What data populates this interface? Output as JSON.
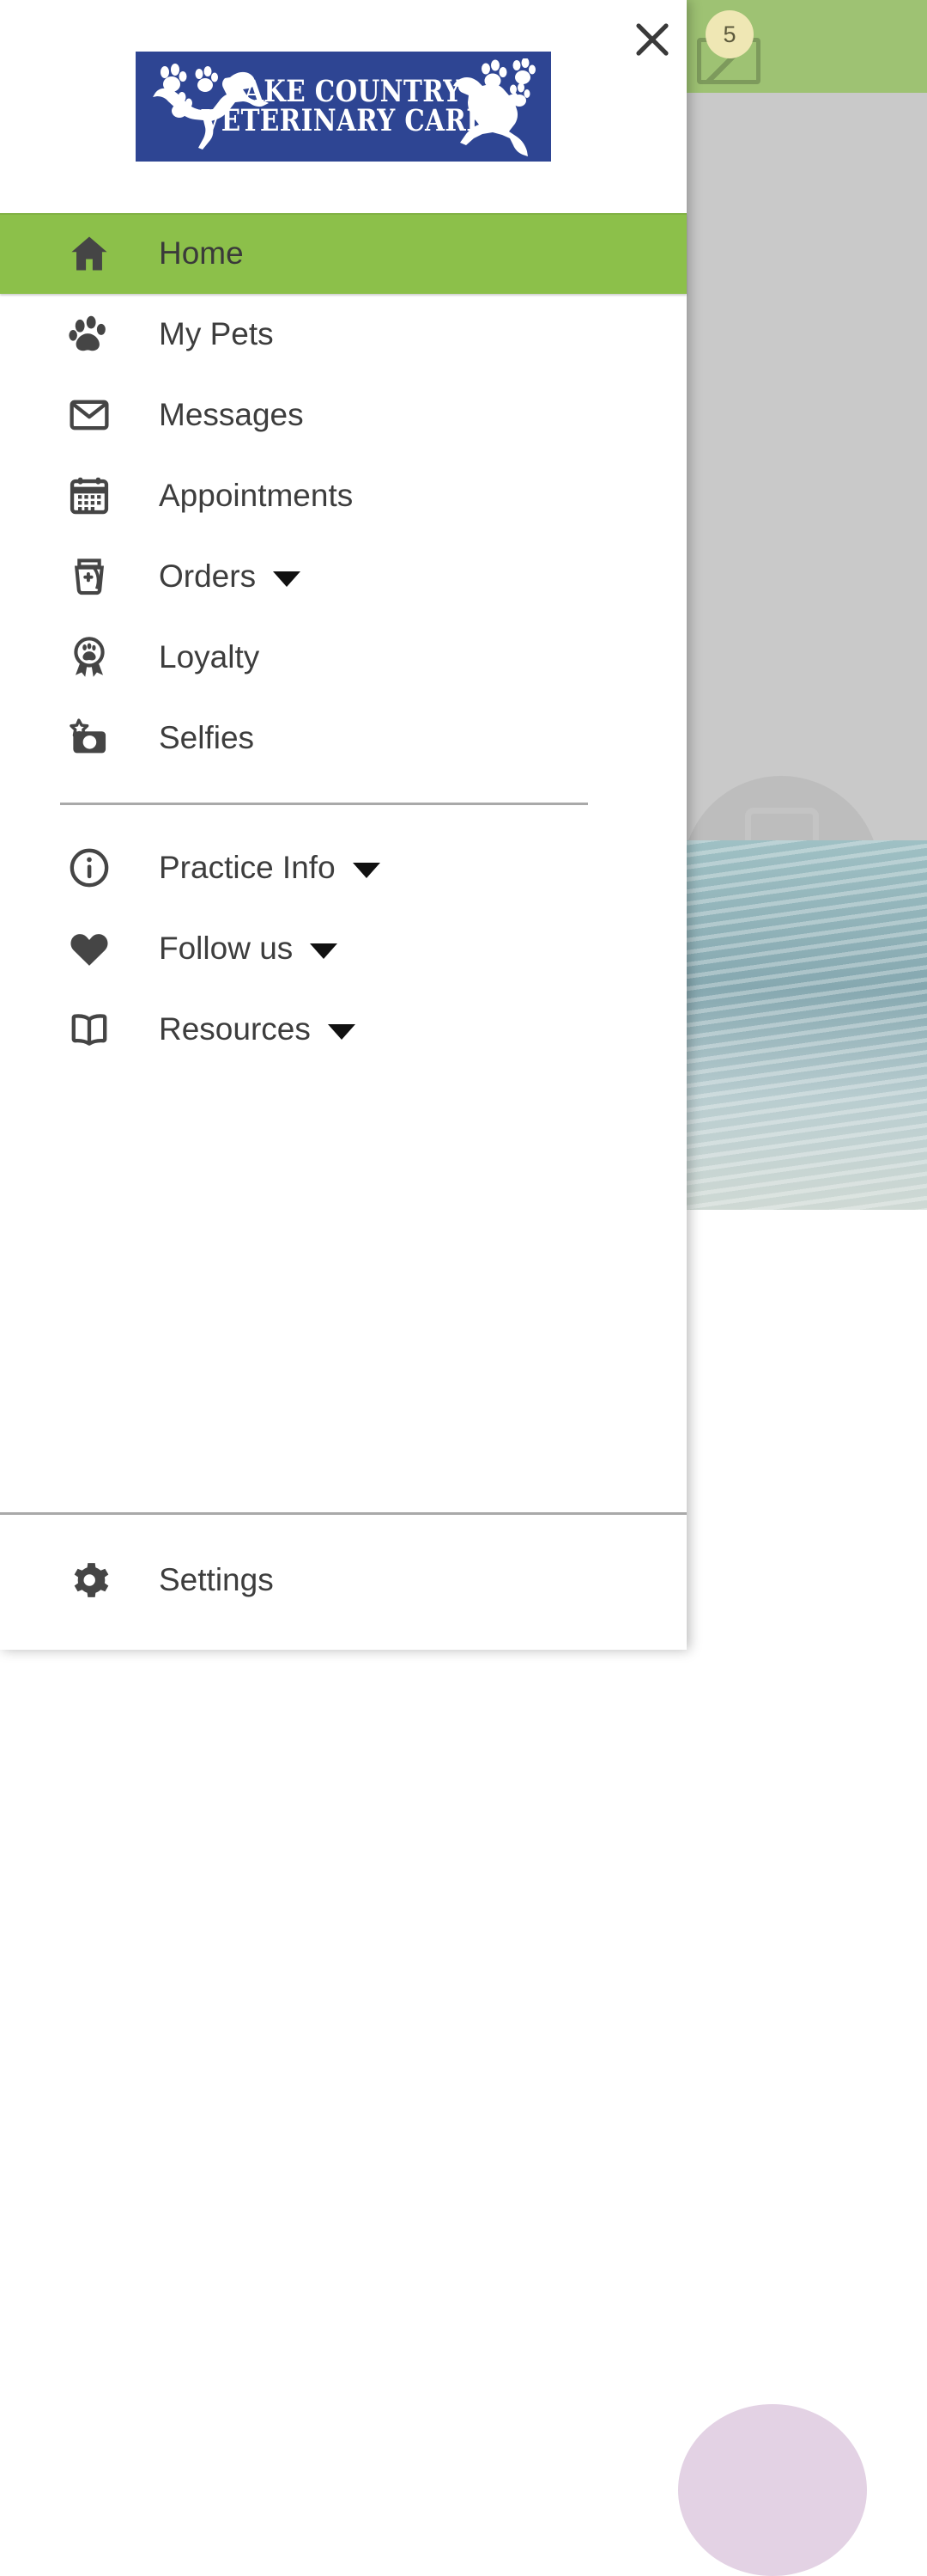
{
  "background_app": {
    "badge_count": "5",
    "envelope_icon": "envelope-icon"
  },
  "drawer": {
    "close_button": {
      "icon": "close-icon",
      "label": "Close"
    },
    "logo": {
      "line1": "Lake Country",
      "line2": "Veterinary Care",
      "background_color": "#2E4593",
      "text_color": "#FFFFFF",
      "dog_icon": "dog-silhouette-icon",
      "cat_icon": "cat-silhouette-icon",
      "paw_icon": "paw-print-icon"
    },
    "accent_color": "#8CC04A",
    "icon_color": "#454545",
    "primary_items": [
      {
        "label": "Home",
        "icon": "home-icon",
        "active": true,
        "expandable": false
      },
      {
        "label": "My Pets",
        "icon": "paw-icon",
        "active": false,
        "expandable": false
      },
      {
        "label": "Messages",
        "icon": "envelope-icon",
        "active": false,
        "expandable": false
      },
      {
        "label": "Appointments",
        "icon": "calendar-icon",
        "active": false,
        "expandable": false
      },
      {
        "label": "Orders",
        "icon": "food-bag-icon",
        "active": false,
        "expandable": true
      },
      {
        "label": "Loyalty",
        "icon": "award-paw-icon",
        "active": false,
        "expandable": false
      },
      {
        "label": "Selfies",
        "icon": "camera-star-icon",
        "active": false,
        "expandable": false
      }
    ],
    "secondary_items": [
      {
        "label": "Practice Info",
        "icon": "info-circle-icon",
        "active": false,
        "expandable": true
      },
      {
        "label": "Follow us",
        "icon": "heart-icon",
        "active": false,
        "expandable": true
      },
      {
        "label": "Resources",
        "icon": "book-icon",
        "active": false,
        "expandable": true
      }
    ],
    "footer_items": [
      {
        "label": "Settings",
        "icon": "gear-icon",
        "active": false,
        "expandable": false
      }
    ]
  }
}
